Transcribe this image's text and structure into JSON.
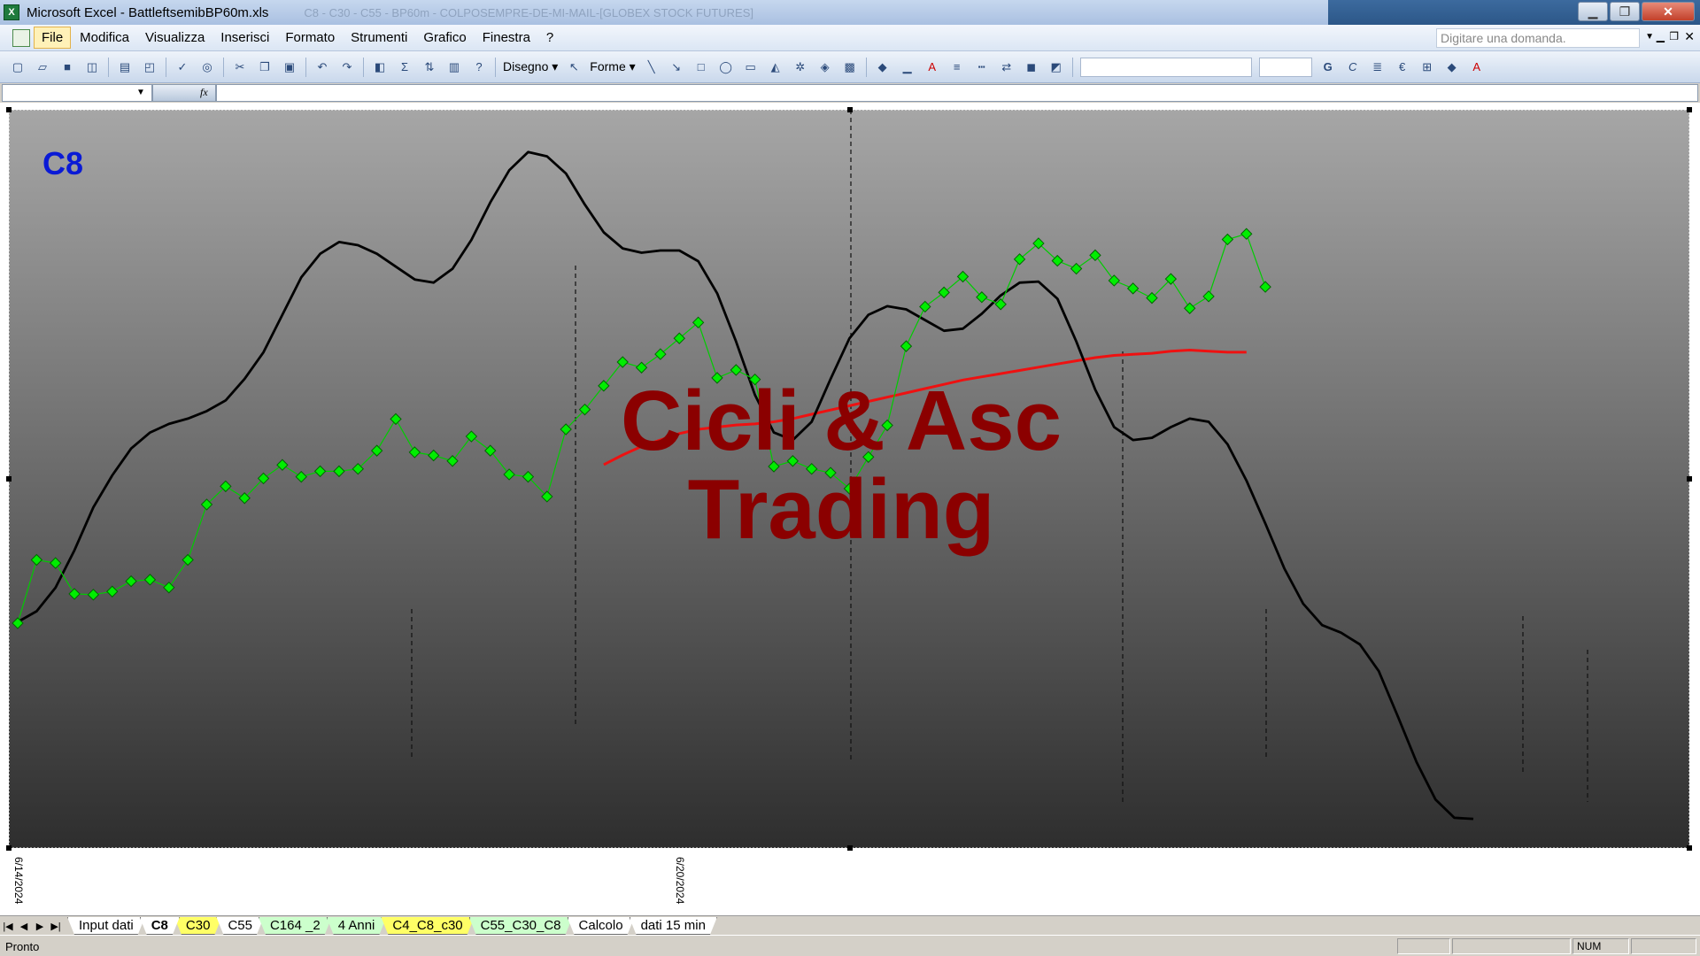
{
  "window": {
    "title": "Microsoft Excel - BattleftsemibBP60m.xls",
    "app_icon": "X",
    "ghost_title": "C8 - C30 - C55 - BP60m - COLPOSEMPRE-DE-MI-MAIL-[GLOBEX STOCK FUTURES]",
    "minimize": "▁",
    "maximize": "❐",
    "close": "✕"
  },
  "menu": {
    "items": [
      "File",
      "Modifica",
      "Visualizza",
      "Inserisci",
      "Formato",
      "Strumenti",
      "Grafico",
      "Finestra",
      "?"
    ],
    "help_placeholder": "Digitare una domanda.",
    "help_dropdown": "▼",
    "mdi_minimize": "▁",
    "mdi_restore": "❐",
    "mdi_close": "✕"
  },
  "toolbar": {
    "icons": [
      "new-icon",
      "open-icon",
      "save-icon",
      "permission-icon",
      "print-icon",
      "print-preview-icon",
      "spelling-icon",
      "research-icon",
      "cut-icon",
      "copy-icon",
      "paste-icon",
      "undo-icon",
      "redo-icon",
      "chart-wizard-icon",
      "sum-icon",
      "sort-icon",
      "chart-icon",
      "help-icon"
    ],
    "drawing_label": "Disegno ▾",
    "shapes_label": "Forme ▾",
    "bold": "G",
    "italic": "C",
    "currency": "€",
    "font_color": "A"
  },
  "formula_bar": {
    "fx": "fx",
    "namebox_dropdown": "▼",
    "value": ""
  },
  "chart": {
    "name": "C8",
    "watermark_line1": "Cicli & Asc",
    "watermark_line2": "Trading",
    "x_labels": [
      "6/14/2024",
      "6/20/2024"
    ],
    "colors": {
      "price_marker": "#00ee00",
      "price_line": "#00cc00",
      "cycle_line": "#000000",
      "trend_line": "#ee1111",
      "title": "#0a1ad6",
      "watermark": "#8b0000",
      "background_top": "#a6a6a6",
      "background_bottom": "#2e2e2e"
    }
  },
  "chart_data": {
    "type": "line",
    "title": "C8",
    "x_labels": [
      "6/14/2024",
      "6/20/2024"
    ],
    "series": [
      {
        "kind": "price",
        "values": [
          55,
          63,
          62.6,
          58.7,
          58.6,
          59,
          60.3,
          60.5,
          59.5,
          63,
          70,
          72.3,
          70.8,
          73.3,
          75,
          73.5,
          74.2,
          74.2,
          74.5,
          76.8,
          80.8,
          76.6,
          76.2,
          75.5,
          78.6,
          76.8,
          73.8,
          73.5,
          71,
          79.5,
          82,
          85,
          88,
          87.3,
          89,
          91,
          93,
          86,
          87,
          85.8,
          74.8,
          75.5,
          74.5,
          74,
          72,
          76,
          80,
          90,
          95,
          96.8,
          98.8,
          96.2,
          95.3,
          101,
          103,
          100.8,
          99.8,
          101.5,
          98.3,
          97.3,
          96.1,
          98.5,
          94.8,
          96.3,
          103.5,
          104.2,
          97.5
        ]
      },
      {
        "kind": "cycle",
        "values": [
          -0.2,
          0.8,
          3,
          6.5,
          10.5,
          13.5,
          16,
          17.5,
          18.3,
          18.8,
          19.5,
          20.5,
          22.5,
          25,
          28.5,
          32,
          34.2,
          35.3,
          35,
          34.2,
          33,
          31.8,
          31.5,
          32.8,
          35.5,
          39,
          42,
          43.7,
          43.3,
          41.7,
          38.8,
          36.2,
          34.7,
          34.3,
          34.5,
          34.5,
          33.5,
          30.5,
          26,
          21,
          17.5,
          16.8,
          18.5,
          22.5,
          26.3,
          28.5,
          29.3,
          29,
          28,
          27,
          27.2,
          28.6,
          30.3,
          31.5,
          31.6,
          30,
          26,
          21.5,
          18,
          16.8,
          17,
          18,
          18.8,
          18.5,
          16.4,
          13,
          9,
          4.8,
          1.5,
          -0.5,
          -1.2,
          -2.3,
          -4.8,
          -9,
          -13.3,
          -16.8,
          -18.5,
          -18.6
        ]
      },
      {
        "kind": "trend",
        "values": [
          14.5,
          15.4,
          16.2,
          16.8,
          17.4,
          17.8,
          18,
          18.2,
          18.3,
          18.5,
          18.8,
          19.2,
          19.6,
          20,
          20.4,
          20.8,
          21.2,
          21.6,
          22,
          22.4,
          22.7,
          23,
          23.3,
          23.6,
          23.9,
          24.2,
          24.5,
          24.7,
          24.8,
          24.9,
          25.1,
          25.2,
          25.1,
          25,
          25
        ]
      }
    ],
    "cycle_low_markers": {
      "dotted_verticals": 8
    },
    "grid": false,
    "legend": "none"
  },
  "sheet_tabs": [
    {
      "label": "Input dati",
      "color": "white",
      "active": false
    },
    {
      "label": "C8",
      "color": "white",
      "active": true
    },
    {
      "label": "C30",
      "color": "yellow",
      "active": false
    },
    {
      "label": "C55",
      "color": "white",
      "active": false
    },
    {
      "label": "C164 _2",
      "color": "green",
      "active": false
    },
    {
      "label": "4 Anni",
      "color": "green",
      "active": false
    },
    {
      "label": "C4_C8_c30",
      "color": "yellow",
      "active": false
    },
    {
      "label": "C55_C30_C8",
      "color": "green",
      "active": false
    },
    {
      "label": "Calcolo",
      "color": "white",
      "active": false
    },
    {
      "label": "dati 15 min",
      "color": "white",
      "active": false
    }
  ],
  "tab_nav": [
    "|◀",
    "◀",
    "▶",
    "▶|"
  ],
  "status": {
    "text": "Pronto",
    "num": "NUM"
  }
}
